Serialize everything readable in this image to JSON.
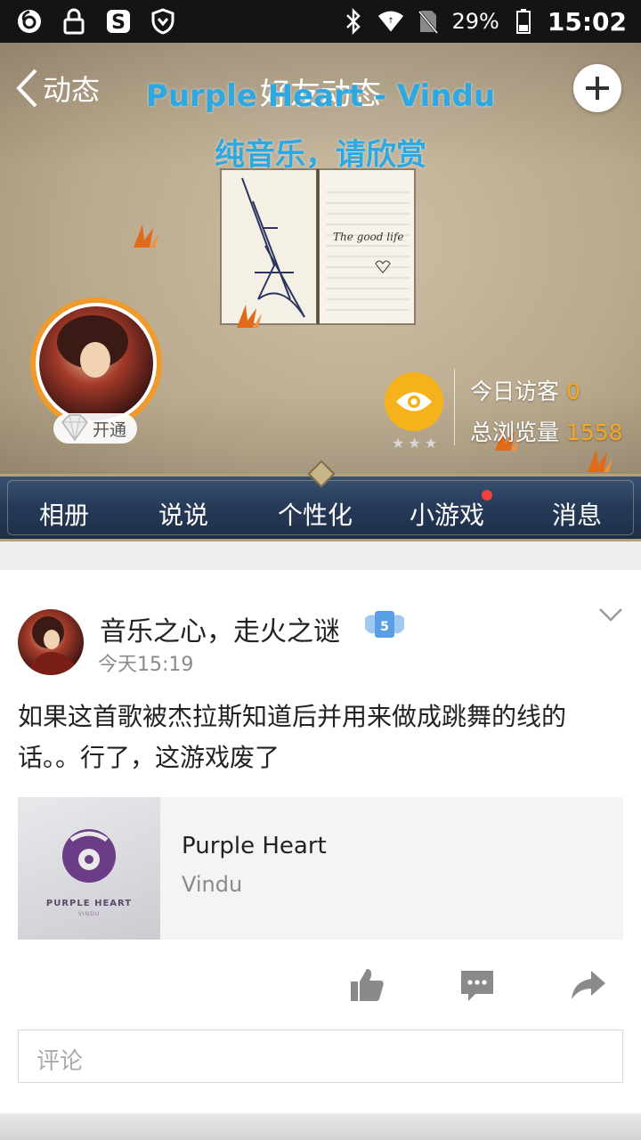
{
  "status_bar": {
    "battery": "29%",
    "time": "15:02"
  },
  "header": {
    "back_label": "动态",
    "title": "好友动态",
    "cover_line1": "Purple Heart - Vindu",
    "cover_line2": "纯音乐，请欣赏",
    "notebook_text": "The good life",
    "vip_label": "开通",
    "visitors_today_label": "今日访客",
    "visitors_today_value": "0",
    "total_views_label": "总浏览量",
    "total_views_value": "1558",
    "stars": "★★★"
  },
  "tabs": [
    {
      "label": "相册"
    },
    {
      "label": "说说"
    },
    {
      "label": "个性化"
    },
    {
      "label": "小游戏",
      "has_dot": true
    },
    {
      "label": "消息"
    }
  ],
  "post": {
    "author": "音乐之心，走火之谜",
    "time": "今天15:19",
    "text": "如果这首歌被杰拉斯知道后并用来做成跳舞的线的话。。行了，这游戏废了",
    "music": {
      "title": "Purple Heart",
      "artist": "Vindu",
      "cover_title": "PURPLE HEART",
      "cover_artist": "VINDU"
    },
    "comment_placeholder": "评论"
  },
  "colors": {
    "accent_blue": "#2ea8e0",
    "visitor_number": "#f5a623",
    "eye_button": "#f5b21b",
    "tab_bar": "#263a58",
    "badge_red": "#f04040"
  }
}
